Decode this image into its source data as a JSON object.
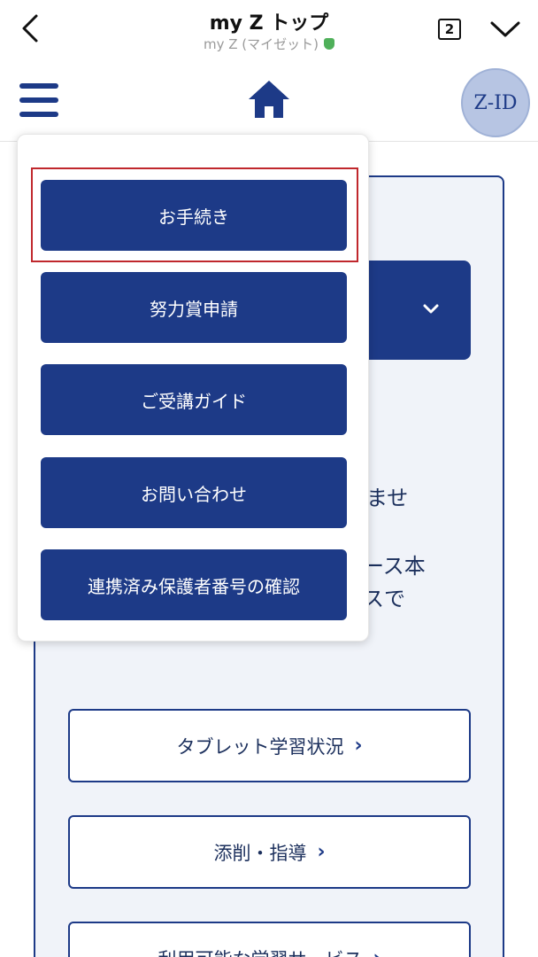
{
  "browser": {
    "title": "my Z トップ",
    "subtitle": "my Z (マイゼット)",
    "tab_count": "2"
  },
  "header": {
    "avatar_label": "Z-ID"
  },
  "menu": {
    "items": [
      {
        "label": "お手続き"
      },
      {
        "label": "努力賞申請"
      },
      {
        "label": "ご受講ガイド"
      },
      {
        "label": "お問い合わせ"
      },
      {
        "label": "連携済み保護者番号の確認"
      }
    ]
  },
  "background": {
    "fragments": [
      "ませ",
      "ース本",
      "スで"
    ],
    "buttons": [
      {
        "label": "タブレット学習状況"
      },
      {
        "label": "添削・指導"
      },
      {
        "label": "利用可能な学習サービス"
      }
    ]
  },
  "colors": {
    "brand": "#1d3a87",
    "highlight": "#c0282d"
  }
}
